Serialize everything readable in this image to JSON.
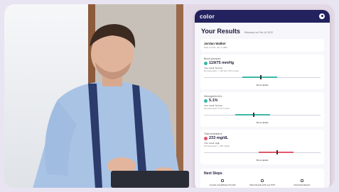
{
  "app": {
    "brand": "color"
  },
  "results": {
    "title": "Your Results",
    "released": "Released on Feb 16 2022"
  },
  "patient": {
    "name": "Jordan Walker",
    "sub": "Date of birth: Jan 1 1983"
  },
  "cards": [
    {
      "label": "Blood pressure",
      "value": "119/75 mmHg",
      "status_color": "#3bb8a7",
      "note": "Your result: Normal",
      "note2": "Normal result: < 120 and <80 mmHg",
      "fill_color": "#3bb8a7",
      "marker_fraction": 0.48,
      "show_details": "Show details"
    },
    {
      "label": "Hemoglobin A1c",
      "value": "5.1%",
      "status_color": "#3bb8a7",
      "note": "Your result: Normal",
      "note2": "Normal result: 5.7% or less",
      "fill_color": "#3bb8a7",
      "marker_fraction": 0.42,
      "show_details": "Show details"
    },
    {
      "label": "Total cholesterol",
      "value": "233 mg/dL",
      "status_color": "#e1576a",
      "note": "Your result: High",
      "note2": "Normal result: < 200 mg/dL",
      "fill_color": "#e1576a",
      "marker_fraction": 0.62,
      "show_details": "Show details"
    }
  ],
  "next_steps": {
    "title": "Next Steps",
    "items": [
      {
        "label": "Consult a Healthcare Provider",
        "icon": "phone-icon"
      },
      {
        "label": "Share Results with your PCP",
        "icon": "share-icon"
      },
      {
        "label": "Download Results",
        "icon": "download-icon"
      }
    ]
  }
}
